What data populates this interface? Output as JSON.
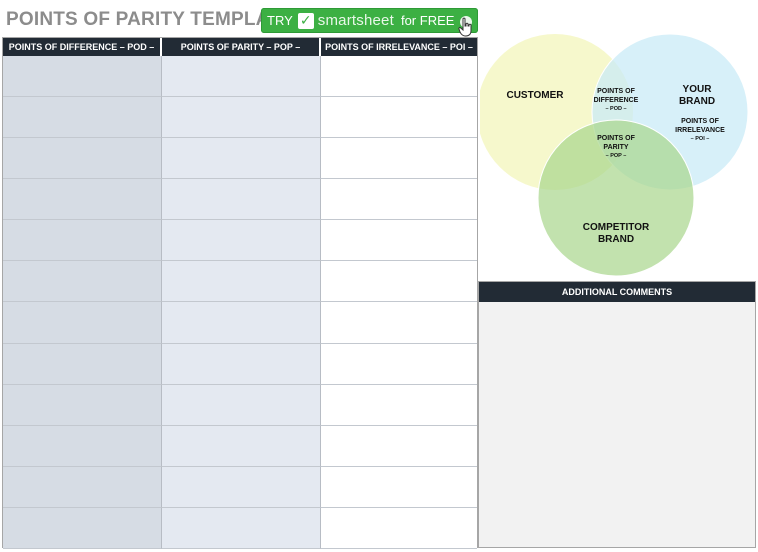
{
  "page_title": "POINTS OF PARITY TEMPLATE",
  "cta": {
    "try": "TRY",
    "brand": "smartsheet",
    "free": "for FREE"
  },
  "table": {
    "headers": [
      "POINTS OF DIFFERENCE – POD –",
      "POINTS OF PARITY – POP –",
      "POINTS OF IRRELEVANCE – POI –"
    ],
    "row_count": 12
  },
  "venn": {
    "customer": "CUSTOMER",
    "your_brand": [
      "YOUR",
      "BRAND"
    ],
    "competitor": [
      "COMPETITOR",
      "BRAND"
    ],
    "pod": [
      "POINTS OF",
      "DIFFERENCE",
      "– POD –"
    ],
    "pop": [
      "POINTS OF",
      "PARITY",
      "– POP –"
    ],
    "poi": [
      "POINTS OF",
      "IRRELEVANCE",
      "– POI –"
    ],
    "colors": {
      "customer": "#f5f7c6",
      "your_brand": "#c9ebf7",
      "competitor": "#a8d68c"
    }
  },
  "comments": {
    "header": "ADDITIONAL COMMENTS"
  },
  "colors": {
    "header_bg": "#222b35",
    "col1_bg": "#d6dce4",
    "col2_bg": "#e4e9f1",
    "cta_bg": "#3cb043"
  }
}
